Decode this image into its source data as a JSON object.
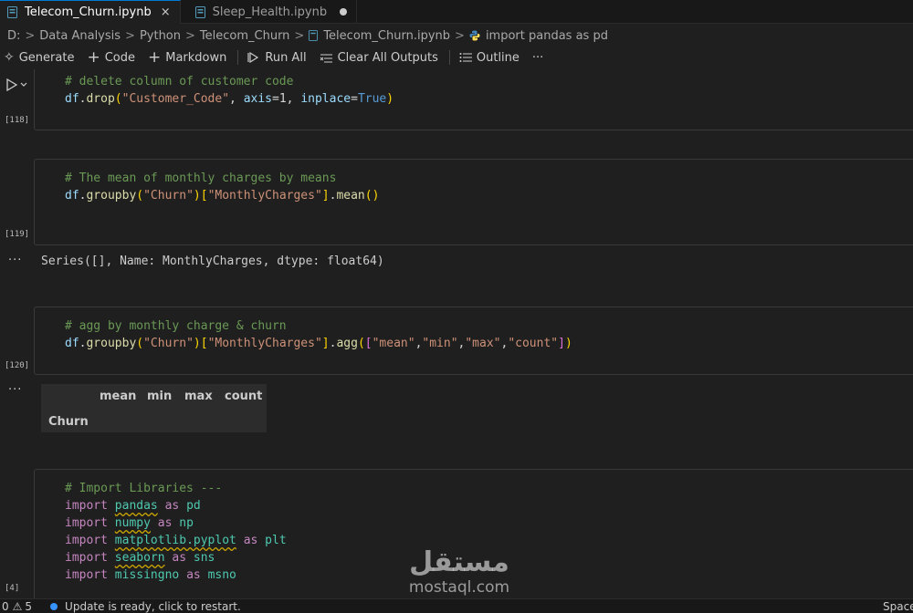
{
  "tabs": [
    {
      "label": "Telecom_Churn.ipynb",
      "active": true,
      "modifier": "×"
    },
    {
      "label": "Sleep_Health.ipynb",
      "active": false,
      "modifier": "dirty-dot"
    }
  ],
  "breadcrumb": {
    "items": [
      "D:",
      "Data Analysis",
      "Python",
      "Telecom_Churn",
      "Telecom_Churn.ipynb",
      "import pandas as pd"
    ],
    "separator": ">"
  },
  "toolbar": {
    "generate": "Generate",
    "code": "Code",
    "markdown": "Markdown",
    "run_all": "Run All",
    "clear_outputs": "Clear All Outputs",
    "outline": "Outline",
    "more": "···"
  },
  "cells": {
    "c118": {
      "count": "[118]",
      "comment": "# delete column of customer code",
      "df": "df",
      "dot": ".",
      "fn": "drop",
      "lp": "(",
      "str": "\"Customer_Code\"",
      "comma1": ", ",
      "axis": "axis",
      "eq1": "=",
      "one": "1",
      "comma2": ", ",
      "inplace": "inplace",
      "eq2": "=",
      "true": "True",
      "rp": ")"
    },
    "c119": {
      "count": "[119]",
      "comment": "# The mean of monthly charges by means",
      "df": "df",
      "dot1": ".",
      "fn1": "groupby",
      "lp1": "(",
      "str1": "\"Churn\"",
      "rp1": ")",
      "lb": "[",
      "str2": "\"MonthlyCharges\"",
      "rb": "]",
      "dot2": ".",
      "fn2": "mean",
      "lp2": "(",
      "rp2": ")",
      "output_ellipsis": "···",
      "output": "Series([], Name: MonthlyCharges, dtype: float64)"
    },
    "c120": {
      "count": "[120]",
      "comment": "# agg by monthly charge & churn",
      "df": "df",
      "dot1": ".",
      "fn1": "groupby",
      "lp1": "(",
      "str1": "\"Churn\"",
      "rp1": ")",
      "lb": "[",
      "str2": "\"MonthlyCharges\"",
      "rb": "]",
      "dot2": ".",
      "fn2": "agg",
      "lp2": "(",
      "lb2": "[",
      "s_mean": "\"mean\"",
      "c1": ",",
      "s_min": "\"min\"",
      "c2": ",",
      "s_max": "\"max\"",
      "c3": ",",
      "s_count": "\"count\"",
      "rb2": "]",
      "rp2": ")",
      "output_ellipsis": "···",
      "table": {
        "columns": [
          "mean",
          "min",
          "max",
          "count"
        ],
        "index_name": "Churn"
      }
    },
    "c4": {
      "count": "[4]",
      "comment": "# Import Libraries ---",
      "imports": [
        {
          "kw": "import",
          "mod": "pandas",
          "as": "as",
          "alias": "pd"
        },
        {
          "kw": "import",
          "mod": "numpy",
          "as": "as",
          "alias": "np"
        },
        {
          "kw": "import",
          "mod": "matplotlib.pyplot",
          "as": "as",
          "alias": "plt"
        },
        {
          "kw": "import",
          "mod": "seaborn",
          "as": "as",
          "alias": "sns"
        },
        {
          "kw": "import",
          "mod": "missingno",
          "as": "as",
          "alias": "msno"
        }
      ]
    }
  },
  "watermark": {
    "arabic": "مستقل",
    "latin": "mostaql.com"
  },
  "status": {
    "errors": "0",
    "warnings": "5",
    "message": "Update is ready, click to restart.",
    "right": "Space"
  },
  "colors": {
    "accent": "#0078d4",
    "comment": "#6a9955",
    "string": "#ce9178",
    "function": "#dcdcaa",
    "keyword": "#c586c0",
    "variable": "#9cdcfe"
  }
}
